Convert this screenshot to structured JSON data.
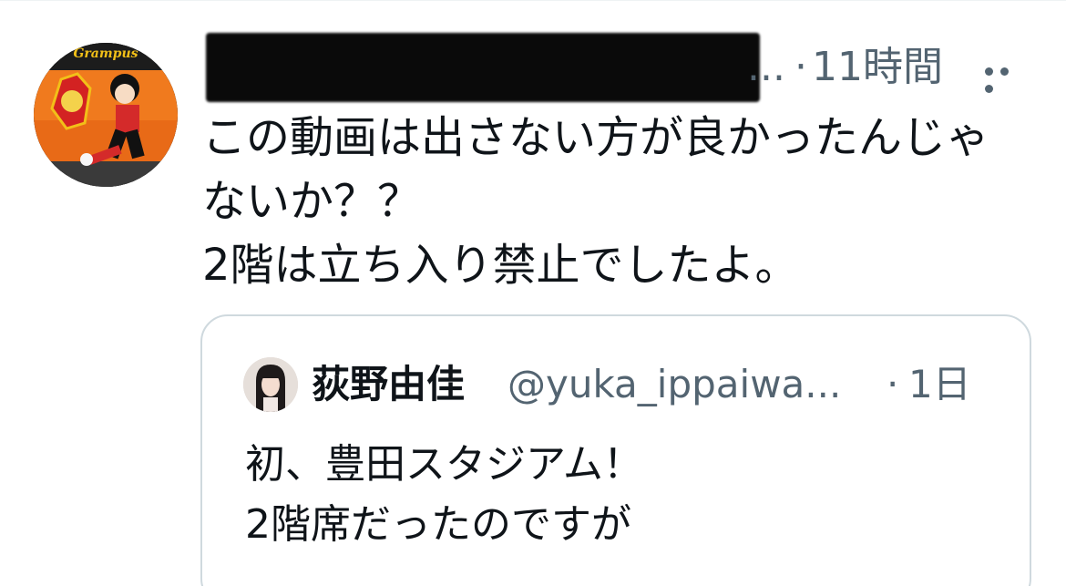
{
  "tweet": {
    "time_label": "11時間",
    "name_truncation": "...",
    "separator": "·",
    "text_lines": [
      "この動画は出さない方が良かったんじゃ",
      "ないか？？",
      "2階は立ち入り禁止でしたよ。"
    ],
    "more_icon": "ellipsis-horizontal-icon",
    "avatar_logo_text": "Grampus"
  },
  "quote": {
    "display_name": "荻野由佳",
    "handle": "@yuka_ippaiwa...",
    "separator": "·",
    "time_label": "1日",
    "text_lines": [
      "初、豊田スタジアム！",
      "2階席だったのですが"
    ]
  },
  "colors": {
    "secondary_text": "#536471",
    "primary_text": "#0f1419",
    "card_border": "#cfd9de"
  }
}
